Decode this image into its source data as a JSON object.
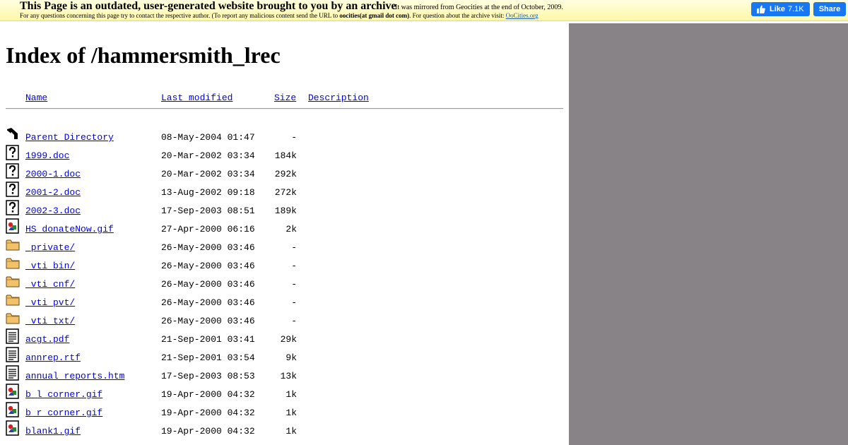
{
  "banner": {
    "title": "This Page is an outdated, user-generated website brought to you by an archive",
    "mirror_note": "It was mirrored from Geocities at the end of October, 2009.",
    "line2_prefix": "For any questions concerning this page try to contact the respective author. (To report any malicious content send the URL to ",
    "email": "oocities(at gmail dot com)",
    "line2_suffix": ". For question about the archive visit: ",
    "archive_link": "OoCities.org"
  },
  "facebook": {
    "like_label": "Like",
    "like_count": "7.1K",
    "share_label": "Share"
  },
  "page_title": "Index of /hammersmith_lrec",
  "columns": {
    "name": "Name",
    "modified": "Last modified",
    "size": "Size",
    "description": "Description"
  },
  "rows": [
    {
      "icon": "back-icon",
      "name": "Parent Directory",
      "modified": "08-May-2004 01:47",
      "size": "-"
    },
    {
      "icon": "unknown-file-icon",
      "name": "1999.doc",
      "modified": "20-Mar-2002 03:34",
      "size": "184k"
    },
    {
      "icon": "unknown-file-icon",
      "name": "2000-1.doc",
      "modified": "20-Mar-2002 03:34",
      "size": "292k"
    },
    {
      "icon": "unknown-file-icon",
      "name": "2001-2.doc",
      "modified": "13-Aug-2002 09:18",
      "size": "272k"
    },
    {
      "icon": "unknown-file-icon",
      "name": "2002-3.doc",
      "modified": "17-Sep-2003 08:51",
      "size": "189k"
    },
    {
      "icon": "image-file-icon",
      "name": "HS_donateNow.gif",
      "modified": "27-Apr-2000 06:16",
      "size": "2k"
    },
    {
      "icon": "folder-icon",
      "name": "_private/",
      "modified": "26-May-2000 03:46",
      "size": "-"
    },
    {
      "icon": "folder-icon",
      "name": "_vti_bin/",
      "modified": "26-May-2000 03:46",
      "size": "-"
    },
    {
      "icon": "folder-icon",
      "name": "_vti_cnf/",
      "modified": "26-May-2000 03:46",
      "size": "-"
    },
    {
      "icon": "folder-icon",
      "name": "_vti_pvt/",
      "modified": "26-May-2000 03:46",
      "size": "-"
    },
    {
      "icon": "folder-icon",
      "name": "_vti_txt/",
      "modified": "26-May-2000 03:46",
      "size": "-"
    },
    {
      "icon": "text-file-icon",
      "name": "acgt.pdf",
      "modified": "21-Sep-2001 03:41",
      "size": "29k"
    },
    {
      "icon": "text-file-icon",
      "name": "annrep.rtf",
      "modified": "21-Sep-2001 03:54",
      "size": "9k"
    },
    {
      "icon": "text-file-icon",
      "name": "annual_reports.htm",
      "modified": "17-Sep-2003 08:53",
      "size": "13k"
    },
    {
      "icon": "image-file-icon",
      "name": "b_l_corner.gif",
      "modified": "19-Apr-2000 04:32",
      "size": "1k"
    },
    {
      "icon": "image-file-icon",
      "name": "b_r_corner.gif",
      "modified": "19-Apr-2000 04:32",
      "size": "1k"
    },
    {
      "icon": "image-file-icon",
      "name": "blank1.gif",
      "modified": "19-Apr-2000 04:32",
      "size": "1k"
    }
  ]
}
